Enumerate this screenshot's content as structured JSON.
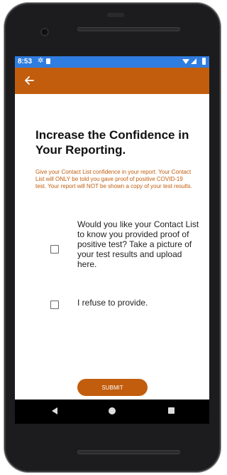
{
  "status_bar": {
    "time": "8:53",
    "gear_icon": "settings-icon",
    "sim_icon": "sim-card-icon",
    "wifi_icon": "wifi-icon",
    "signal_icon": "cell-signal-icon",
    "battery_icon": "battery-icon",
    "color": "#2f7de1"
  },
  "app_bar": {
    "back_icon": "arrow-left-icon",
    "color": "#c15d0d"
  },
  "main": {
    "title": "Increase the Confidence in Your Reporting.",
    "info": "Give your Contact List confidence in your report. Your Contact List will ONLY be told you gave proof of positive COVID-19 test.  Your report will NOT be shown a copy of your test results.",
    "options": [
      {
        "label": "Would you like your Contact List to know you provided proof of positive test? Take a picture of your test results and upload here.",
        "checked": false
      },
      {
        "label": "I refuse to provide.",
        "checked": false
      }
    ],
    "submit_label": "SUBMIT"
  },
  "nav_bar": {
    "back_icon": "nav-back-icon",
    "home_icon": "nav-home-icon",
    "recents_icon": "nav-recents-icon"
  }
}
